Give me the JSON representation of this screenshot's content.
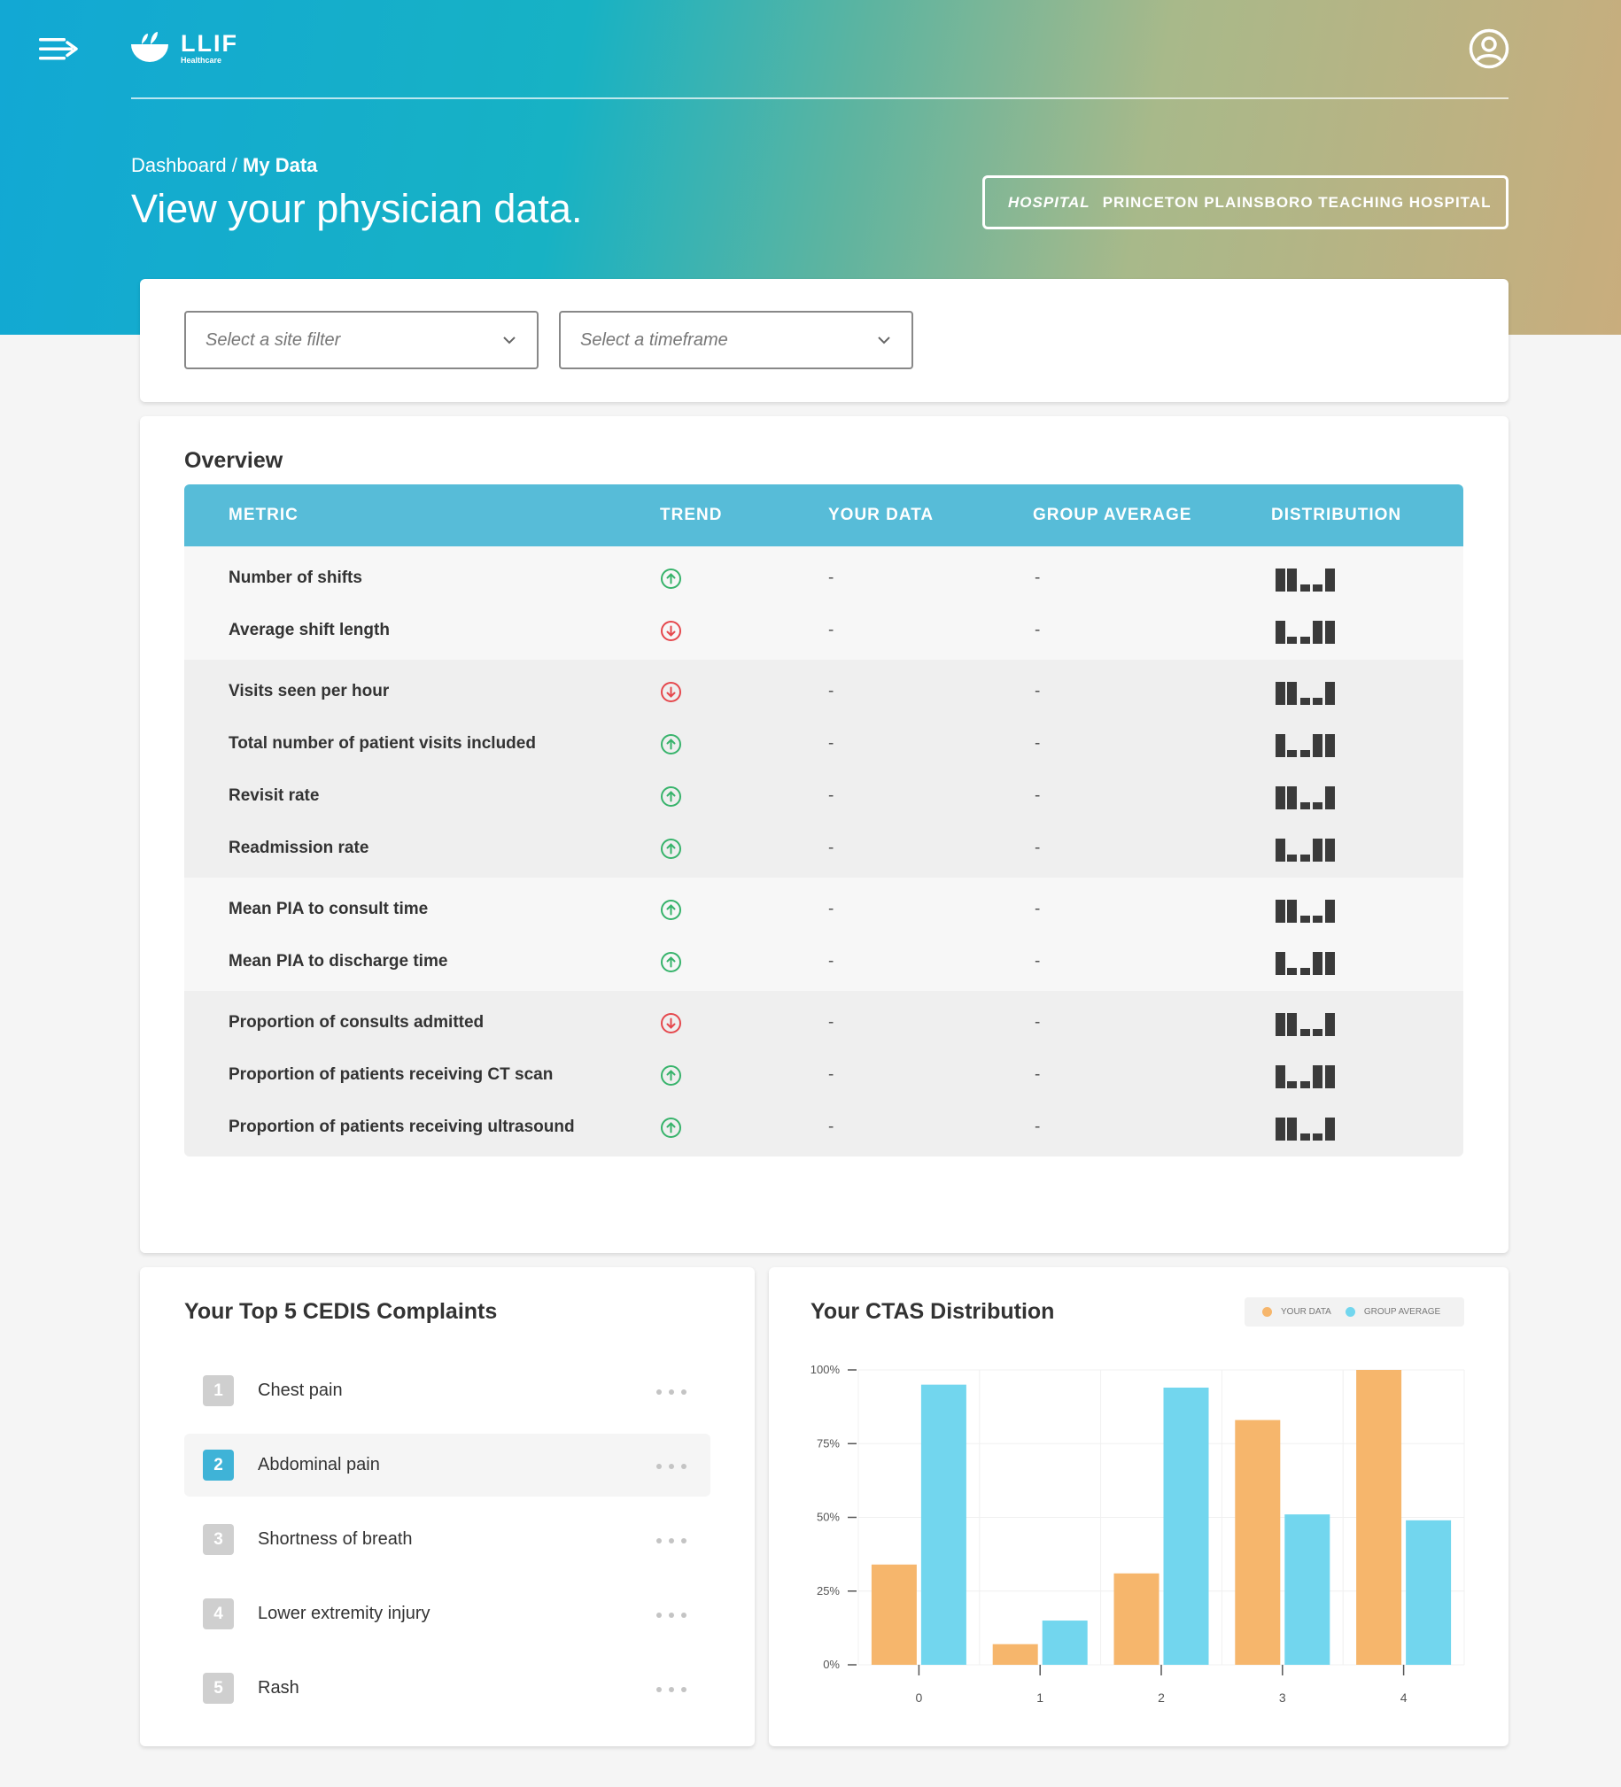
{
  "brand": {
    "name": "LLIF",
    "sub": "Healthcare"
  },
  "breadcrumb": {
    "parent": "Dashboard",
    "separator": "/",
    "current": "My Data"
  },
  "page_title": "View your physician data.",
  "hospital": {
    "label": "HOSPITAL",
    "value": "PRINCETON PLAINSBORO TEACHING HOSPITAL"
  },
  "filters": {
    "site_placeholder": "Select a site filter",
    "timeframe_placeholder": "Select a timeframe"
  },
  "overview": {
    "title": "Overview",
    "headers": {
      "metric": "METRIC",
      "trend": "TREND",
      "your_data": "YOUR DATA",
      "group_average": "GROUP AVERAGE",
      "distribution": "DISTRIBUTION"
    },
    "groups": [
      {
        "shade": "light",
        "rows": [
          {
            "metric": "Number of shifts",
            "trend": "up",
            "your": "-",
            "group": "-",
            "dist": "A"
          },
          {
            "metric": "Average shift length",
            "trend": "down",
            "your": "-",
            "group": "-",
            "dist": "B"
          }
        ]
      },
      {
        "shade": "dark",
        "rows": [
          {
            "metric": "Visits seen per hour",
            "trend": "down",
            "your": "-",
            "group": "-",
            "dist": "A"
          },
          {
            "metric": "Total number of patient visits included",
            "trend": "up",
            "your": "-",
            "group": "-",
            "dist": "B"
          },
          {
            "metric": "Revisit rate",
            "trend": "up",
            "your": "-",
            "group": "-",
            "dist": "A"
          },
          {
            "metric": "Readmission rate",
            "trend": "up",
            "your": "-",
            "group": "-",
            "dist": "B"
          }
        ]
      },
      {
        "shade": "light",
        "rows": [
          {
            "metric": "Mean PIA to consult time",
            "trend": "up",
            "your": "-",
            "group": "-",
            "dist": "A"
          },
          {
            "metric": "Mean PIA to discharge time",
            "trend": "up",
            "your": "-",
            "group": "-",
            "dist": "B"
          }
        ]
      },
      {
        "shade": "dark",
        "rows": [
          {
            "metric": "Proportion of consults admitted",
            "trend": "down",
            "your": "-",
            "group": "-",
            "dist": "A"
          },
          {
            "metric": "Proportion of patients receiving CT scan",
            "trend": "up",
            "your": "-",
            "group": "-",
            "dist": "B"
          },
          {
            "metric": "Proportion of patients receiving ultrasound",
            "trend": "up",
            "your": "-",
            "group": "-",
            "dist": "A"
          }
        ]
      }
    ]
  },
  "cedis": {
    "title": "Your Top 5 CEDIS Complaints",
    "items": [
      {
        "rank": "1",
        "label": "Chest pain"
      },
      {
        "rank": "2",
        "label": "Abdominal pain"
      },
      {
        "rank": "3",
        "label": "Shortness of breath"
      },
      {
        "rank": "4",
        "label": "Lower extremity injury"
      },
      {
        "rank": "5",
        "label": "Rash"
      }
    ],
    "active_index": 1
  },
  "ctas": {
    "title": "Your CTAS Distribution",
    "legend": {
      "your": "YOUR DATA",
      "group": "GROUP AVERAGE"
    }
  },
  "colors": {
    "your_data": "#f6b66c",
    "group_average": "#72d6ee",
    "trend_up": "#37b36b",
    "trend_down": "#e5484d",
    "header": "#57bcd8"
  },
  "chart_data": {
    "type": "bar",
    "title": "Your CTAS Distribution",
    "categories": [
      "0",
      "1",
      "2",
      "3",
      "4"
    ],
    "series": [
      {
        "name": "YOUR DATA",
        "values": [
          34,
          7,
          31,
          83,
          100
        ]
      },
      {
        "name": "GROUP AVERAGE",
        "values": [
          95,
          15,
          94,
          51,
          49
        ]
      }
    ],
    "y_ticks": [
      "0%",
      "25%",
      "50%",
      "75%",
      "100%"
    ],
    "ylim": [
      0,
      100
    ],
    "grid": true,
    "legend_position": "top-right"
  }
}
